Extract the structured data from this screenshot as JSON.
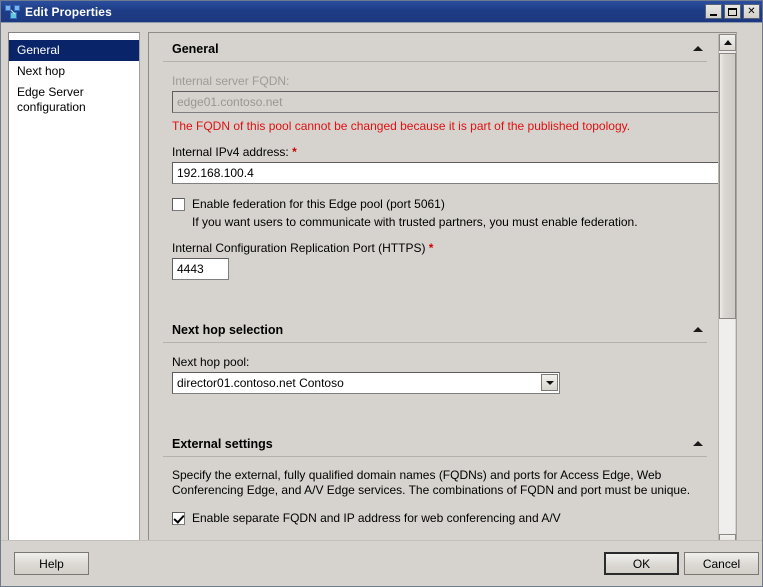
{
  "window": {
    "title": "Edit Properties",
    "icon": "lync-topology-icon",
    "controls": {
      "minimize": "minimize-icon",
      "maximize": "maximize-icon",
      "close": "✕"
    }
  },
  "nav": {
    "items": [
      {
        "label": "General",
        "selected": true
      },
      {
        "label": "Next hop",
        "selected": false
      },
      {
        "label": "Edge Server configuration",
        "selected": false
      }
    ]
  },
  "sections": {
    "general": {
      "title": "General",
      "collapse_state": "expanded",
      "fqdn": {
        "label": "Internal server FQDN:",
        "value": "edge01.contoso.net",
        "disabled": true,
        "error": "The FQDN of this pool cannot be changed because it is part of the published topology."
      },
      "ipv4": {
        "label": "Internal IPv4 address:",
        "required_marker": "*",
        "value": "192.168.100.4"
      },
      "federation": {
        "label": "Enable federation for this Edge pool (port 5061)",
        "checked": false,
        "sub_text": "If you want users to communicate with trusted partners, you must enable federation."
      },
      "replication_port": {
        "label": "Internal Configuration Replication Port (HTTPS)",
        "required_marker": "*",
        "value": "4443"
      }
    },
    "next_hop": {
      "title": "Next hop selection",
      "collapse_state": "expanded",
      "pool": {
        "label": "Next hop pool:",
        "value": "director01.contoso.net   Contoso",
        "dropdown_icon": "chevron-down-icon"
      }
    },
    "external": {
      "title": "External settings",
      "collapse_state": "expanded",
      "description": "Specify the external, fully qualified domain names (FQDNs) and ports for Access Edge, Web Conferencing Edge, and A/V Edge services. The combinations of FQDN and port must be unique.",
      "separate_fqdn": {
        "label": "Enable separate FQDN and IP address for web conferencing and A/V",
        "checked": true
      }
    }
  },
  "footer": {
    "help": "Help",
    "ok": "OK",
    "cancel": "Cancel"
  },
  "colors": {
    "titlebar": "#1e3c86",
    "dialog_bg": "#d6d3ce",
    "selection": "#0a246a",
    "error_text": "#e01010",
    "required": "#d40000"
  }
}
